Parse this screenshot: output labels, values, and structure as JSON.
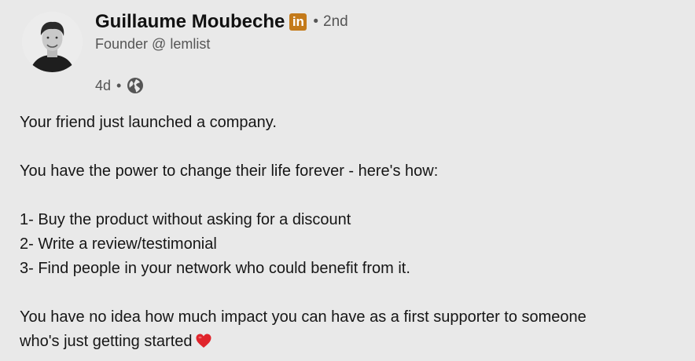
{
  "post": {
    "author": {
      "name": "Guillaume Moubeche",
      "badge_icon": "linkedin-premium-badge-icon",
      "badge_text": "in",
      "badge_color": "#c47a1a",
      "degree_separator": "•",
      "degree": "2nd",
      "headline": "Founder @ lemlist"
    },
    "meta": {
      "time": "4d",
      "separator": "•",
      "visibility_icon": "globe-icon"
    },
    "body": {
      "line1": "Your friend just launched a company.",
      "line2": "You have the power to change their life forever - here's how:",
      "item1": "1- Buy the product without asking for a discount",
      "item2": "2- Write a review/testimonial",
      "item3": "3- Find people in your network who could benefit from it.",
      "line3": "You have no idea how much impact you can have as a first supporter to someone",
      "line4": "who's just getting started",
      "emoji_icon": "red-heart-icon"
    }
  }
}
